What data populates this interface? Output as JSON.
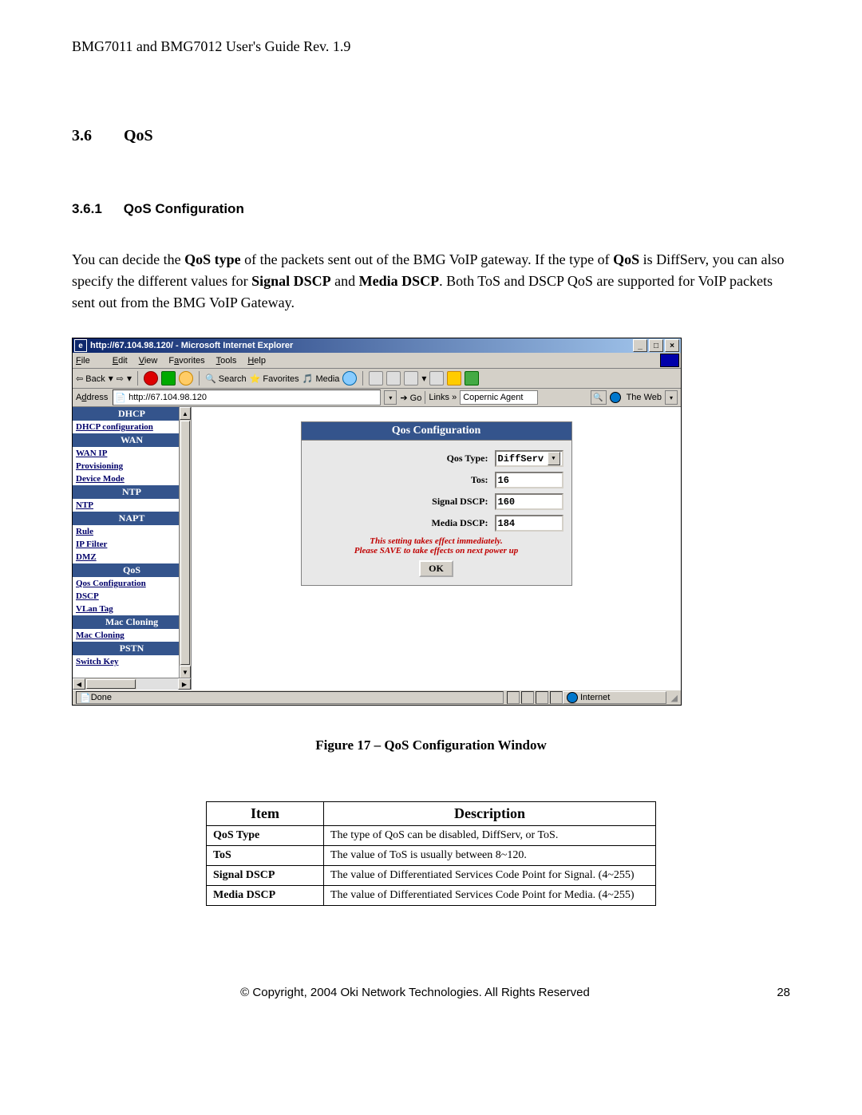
{
  "doc_header": "BMG7011 and BMG7012 User's Guide Rev. 1.9",
  "section": {
    "num": "3.6",
    "title": "QoS"
  },
  "subsection": {
    "num": "3.6.1",
    "title": "QoS Configuration"
  },
  "body": {
    "p1a": "You can decide the ",
    "p1b": "QoS type",
    "p1c": " of the packets sent out of the BMG VoIP gateway. If the type of ",
    "p1d": "QoS",
    "p1e": " is DiffServ, you can also specify the different values for ",
    "p1f": "Signal DSCP",
    "p1g": " and ",
    "p1h": "Media DSCP",
    "p1i": ". Both ToS and DSCP QoS are supported for VoIP packets sent out from the BMG VoIP Gateway."
  },
  "ie": {
    "title": "http://67.104.98.120/ - Microsoft Internet Explorer",
    "menu": {
      "file": "File",
      "edit": "Edit",
      "view": "View",
      "fav": "Favorites",
      "tools": "Tools",
      "help": "Help"
    },
    "tb": {
      "back": "Back",
      "search": "Search",
      "fav": "Favorites",
      "media": "Media"
    },
    "addr": {
      "label": "Address",
      "value": "http://67.104.98.120",
      "go": "Go",
      "links": "Links",
      "agent": "Copernic Agent",
      "theweb": "The Web"
    },
    "status": {
      "done": "Done",
      "zone": "Internet"
    }
  },
  "sidebar": {
    "dhcp_h": "DHCP",
    "dhcp_conf": "DHCP configuration",
    "wan_h": "WAN",
    "wan_ip": "WAN IP",
    "prov": "Provisioning",
    "devmode": "Device Mode",
    "ntp_h": "NTP",
    "ntp": "NTP",
    "napt_h": "NAPT",
    "rule": "Rule",
    "ipfilter": "IP Filter",
    "dmz": "DMZ",
    "qos_h": "QoS",
    "qos_conf": "Qos Configuration",
    "dscp": "DSCP",
    "vlan": "VLan Tag",
    "mac_h": "Mac Cloning",
    "mac": "Mac Cloning",
    "pstn_h": "PSTN",
    "switch": "Switch Key"
  },
  "panel": {
    "title": "Qos Configuration",
    "qos_type_label": "Qos Type:",
    "qos_type_value": "DiffServ",
    "tos_label": "Tos:",
    "tos_value": "16",
    "signal_label": "Signal DSCP:",
    "signal_value": "160",
    "media_label": "Media DSCP:",
    "media_value": "184",
    "warn1": "This setting takes effect immediately.",
    "warn2": "Please SAVE to take effects on next power up",
    "ok": "OK"
  },
  "figure": "Figure 17 – QoS Configuration Window",
  "table": {
    "h_item": "Item",
    "h_desc": "Description",
    "rows": [
      {
        "item": "QoS Type",
        "desc": "The type of QoS can be disabled, DiffServ, or ToS."
      },
      {
        "item": "ToS",
        "desc": "The value of ToS is usually between 8~120."
      },
      {
        "item": "Signal DSCP",
        "desc": "The value of Differentiated Services Code Point for Signal. (4~255)"
      },
      {
        "item": "Media DSCP",
        "desc": "The value of Differentiated Services Code Point for Media. (4~255)"
      }
    ]
  },
  "footer": {
    "copyright": "© Copyright, 2004 Oki Network Technologies. All Rights Reserved",
    "page": "28"
  }
}
